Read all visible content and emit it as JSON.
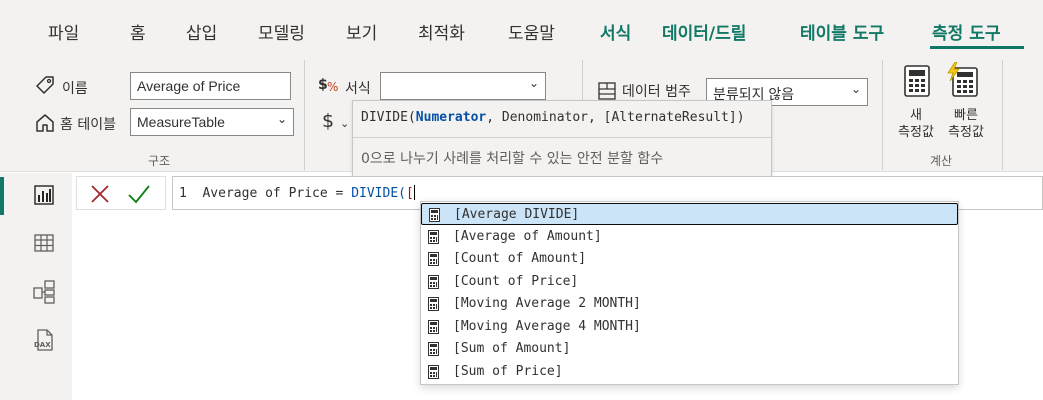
{
  "tabs": [
    {
      "label": "파일"
    },
    {
      "label": "홈"
    },
    {
      "label": "삽입"
    },
    {
      "label": "모델링"
    },
    {
      "label": "보기"
    },
    {
      "label": "최적화"
    },
    {
      "label": "도움말"
    },
    {
      "label": "서식"
    },
    {
      "label": "데이터/드릴"
    },
    {
      "label": "테이블 도구"
    },
    {
      "label": "측정 도구"
    }
  ],
  "structure": {
    "name_label": "이름",
    "name_value": "Average of Price",
    "home_table_label": "홈 테이블",
    "home_table_value": "MeasureTable",
    "group_label": "구조"
  },
  "formatting": {
    "format_label": "서식",
    "format_value": "",
    "currency_symbol": "$"
  },
  "properties": {
    "data_category_label": "데이터 범주",
    "data_category_value": "분류되지 않음"
  },
  "calculations": {
    "new_measure_line1": "새",
    "new_measure_line2": "측정값",
    "quick_measure_line1": "빠른",
    "quick_measure_line2": "측정값",
    "group_label": "계산"
  },
  "tooltip": {
    "function_name": "DIVIDE(",
    "param_bold": "Numerator",
    "params_rest": ", Denominator, [AlternateResult])",
    "description": "0으로 나누기 사례를 처리할 수 있는 안전 분할 함수"
  },
  "formula": {
    "line_number": "1",
    "prefix": "Average of Price = ",
    "function": "DIVIDE(",
    "bracket": "["
  },
  "suggestions": [
    "[Average DIVIDE]",
    "[Average of Amount]",
    "[Count of Amount]",
    "[Count of Price]",
    "[Moving Average 2 MONTH]",
    "[Moving Average 4 MONTH]",
    "[Sum of Amount]",
    "[Sum of Price]"
  ],
  "colors": {
    "accent": "#117865",
    "selection": "#cce4f7",
    "cancel": "#a4262c",
    "commit": "#107c10"
  }
}
